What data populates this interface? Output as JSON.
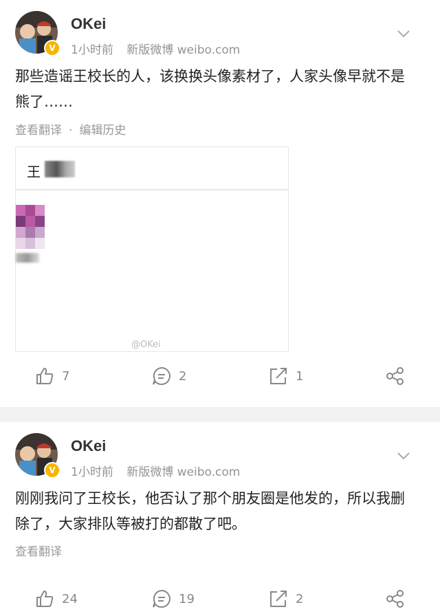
{
  "posts": [
    {
      "user": "OKei",
      "verified_badge": "V",
      "time": "1小时前",
      "source": "新版微博 weibo.com",
      "text_line1": "那些造谣王校长的人，该换换头像素材了，人家头像早就不是",
      "text_line2": "熊了……",
      "links": {
        "translate": "查看翻译",
        "separator": "·",
        "edit_history": "编辑历史"
      },
      "embed": {
        "name_char": "王",
        "watermark": "@OKei"
      },
      "actions": {
        "likes": "7",
        "comments": "2",
        "reposts": "1"
      }
    },
    {
      "user": "OKei",
      "verified_badge": "V",
      "time": "1小时前",
      "source": "新版微博 weibo.com",
      "text_line1": "刚刚我问了王校长，他否认了那个朋友圈是他发的，所以我删",
      "text_line2": "除了，大家排队等被打的都散了吧。",
      "links": {
        "translate": "查看翻译"
      },
      "actions": {
        "likes": "24",
        "comments": "19",
        "reposts": "2"
      }
    }
  ],
  "colors": {
    "badge": "#f7b500",
    "muted": "#939393",
    "divider": "#f2f2f2"
  },
  "icons": [
    "chevron-down-icon",
    "like-icon",
    "comment-icon",
    "repost-icon",
    "share-icon",
    "verified-icon"
  ]
}
